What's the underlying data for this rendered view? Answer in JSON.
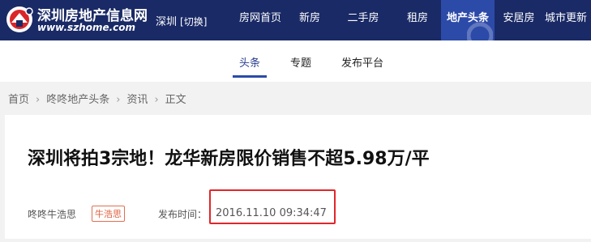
{
  "header": {
    "logo_cn": "深圳房地产信息网",
    "logo_en": "www.szhome.com",
    "city": "深圳",
    "city_switch": "[切换]",
    "nav": [
      "房网首页",
      "新房",
      "二手房",
      "租房",
      "地产头条",
      "安居房",
      "城市更新"
    ],
    "active_nav": "地产头条",
    "colors": {
      "bar": "#1a2a66",
      "active": "#2c4aa8"
    }
  },
  "subnav": {
    "tabs": [
      "头条",
      "专题",
      "发布平台"
    ],
    "active_tab": "头条"
  },
  "breadcrumb": [
    "首页",
    "咚咚地产头条",
    "资讯",
    "正文"
  ],
  "article": {
    "title": "深圳将拍3宗地！龙华新房限价销售不超5.98万/平",
    "author": "咚咚牛浩思",
    "author_tag": "牛浩思",
    "publish_label": "发布时间：",
    "publish_time": "2016.11.10 09:34:47",
    "highlight_color": "#e0262a"
  }
}
